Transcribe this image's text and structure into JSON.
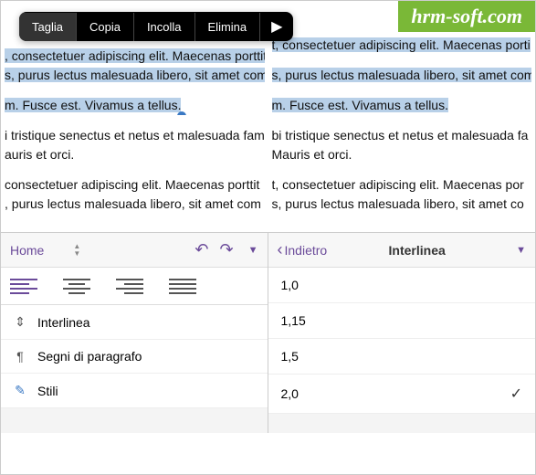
{
  "watermark": "hrm-soft.com",
  "context_menu": {
    "items": [
      "Taglia",
      "Copia",
      "Incolla",
      "Elimina"
    ],
    "more": "▶"
  },
  "doc": {
    "left": {
      "p1": ", consectetuer adipiscing elit. Maecenas porttit",
      "p2": "s, purus lectus malesuada libero, sit amet com",
      "p3": "m. Fusce est. Vivamus a tellus.",
      "p4": "i tristique senectus et netus et malesuada fam",
      "p5": "auris et orci.",
      "p6": " consectetuer adipiscing elit. Maecenas porttit",
      "p7": ", purus lectus malesuada libero, sit amet com"
    },
    "right": {
      "p1": "t, consectetuer adipiscing elit. Maecenas porti",
      "p2": "s, purus lectus malesuada libero, sit amet com",
      "p3": "m. Fusce est. Vivamus a tellus.",
      "p4": "bi tristique senectus et netus et malesuada fa",
      "p5": "Mauris et orci.",
      "p6": "t, consectetuer adipiscing elit. Maecenas por",
      "p7": "s, purus lectus malesuada libero, sit amet co"
    }
  },
  "left_panel": {
    "tab": "Home",
    "format": {
      "interlinea": "Interlinea",
      "paragrafo": "Segni di paragrafo",
      "stili": "Stili"
    }
  },
  "right_panel": {
    "back": "Indietro",
    "title": "Interlinea",
    "options": [
      "1,0",
      "1,15",
      "1,5",
      "2,0"
    ],
    "selected_index": 3
  }
}
